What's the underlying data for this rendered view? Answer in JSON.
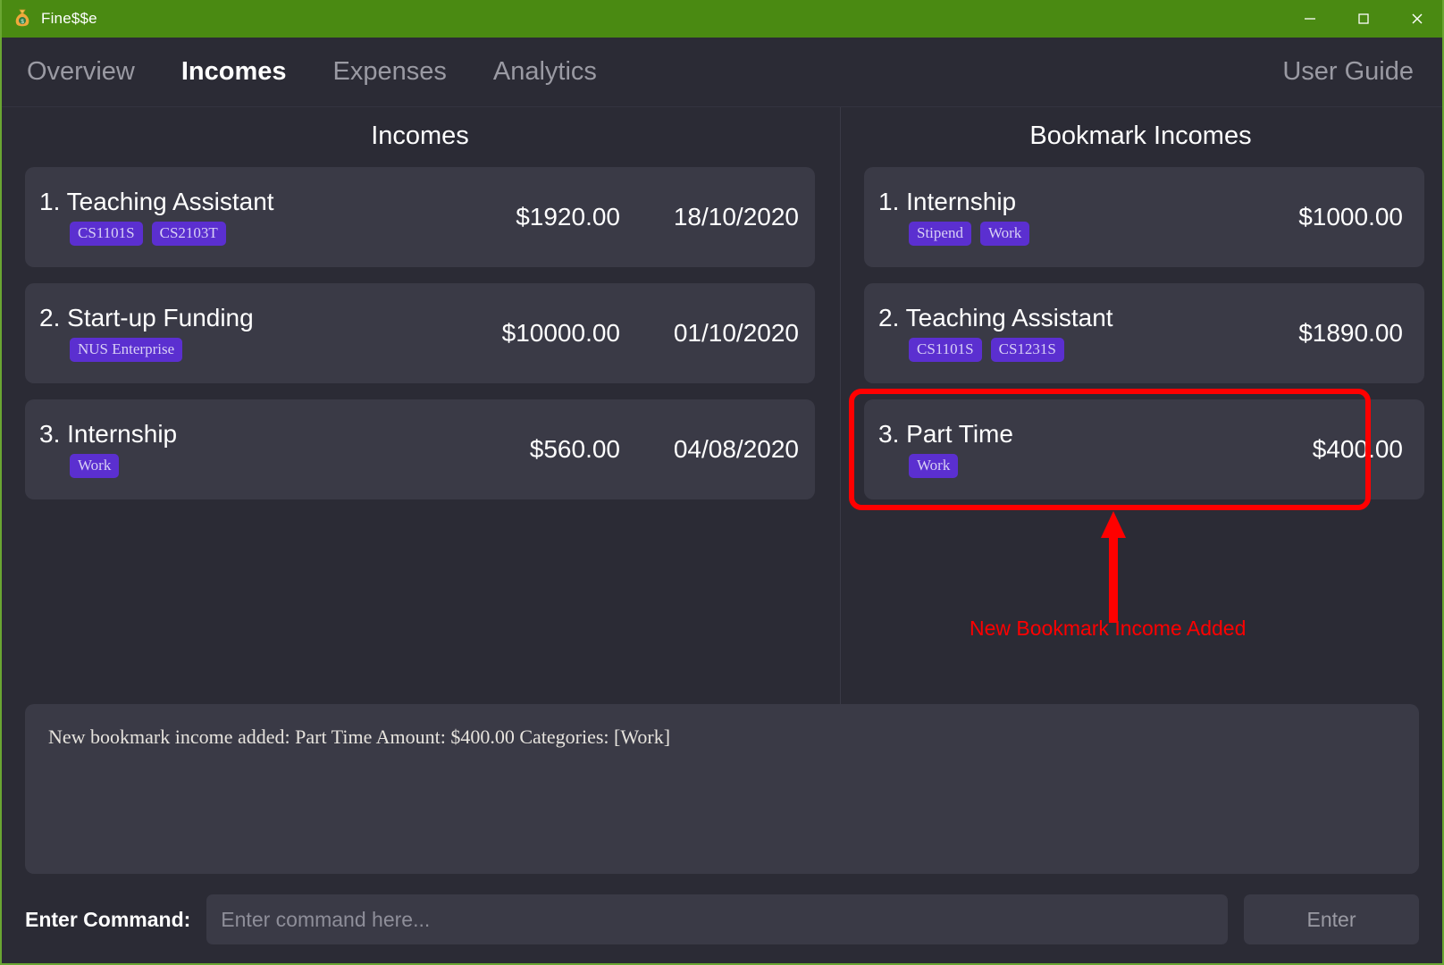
{
  "window": {
    "title": "Fine$$e",
    "icon": "money-bag-icon",
    "accent_color": "#4a8a12",
    "controls": {
      "minimize": "—",
      "maximize": "□",
      "close": "✕"
    }
  },
  "nav": {
    "items": [
      {
        "label": "Overview",
        "active": false
      },
      {
        "label": "Incomes",
        "active": true
      },
      {
        "label": "Expenses",
        "active": false
      },
      {
        "label": "Analytics",
        "active": false
      }
    ],
    "right_link": "User Guide"
  },
  "panels": {
    "left": {
      "title": "Incomes",
      "entries": [
        {
          "index": "1.",
          "name": "Teaching Assistant",
          "tags": [
            "CS1101S",
            "CS2103T"
          ],
          "amount": "$1920.00",
          "date": "18/10/2020"
        },
        {
          "index": "2.",
          "name": "Start-up Funding",
          "tags": [
            "NUS Enterprise"
          ],
          "amount": "$10000.00",
          "date": "01/10/2020"
        },
        {
          "index": "3.",
          "name": "Internship",
          "tags": [
            "Work"
          ],
          "amount": "$560.00",
          "date": "04/08/2020"
        }
      ]
    },
    "right": {
      "title": "Bookmark Incomes",
      "entries": [
        {
          "index": "1.",
          "name": "Internship",
          "tags": [
            "Stipend",
            "Work"
          ],
          "amount": "$1000.00",
          "date": ""
        },
        {
          "index": "2.",
          "name": "Teaching Assistant",
          "tags": [
            "CS1101S",
            "CS1231S"
          ],
          "amount": "$1890.00",
          "date": ""
        },
        {
          "index": "3.",
          "name": "Part Time",
          "tags": [
            "Work"
          ],
          "amount": "$400.00",
          "date": ""
        }
      ]
    }
  },
  "annotation": {
    "label": "New Bookmark Income Added",
    "color": "#ff0000",
    "highlight_target": "bookmark-entry-3-part-time"
  },
  "log": {
    "lines": [
      "New bookmark income added: Part Time Amount: $400.00 Categories: [Work]"
    ]
  },
  "command_bar": {
    "label": "Enter Command:",
    "placeholder": "Enter command here...",
    "value": "",
    "button_label": "Enter"
  },
  "colors": {
    "titlebar": "#4a8a12",
    "background": "#2b2b35",
    "card": "#3a3a46",
    "tag": "#5b2fd0",
    "tag_text": "#d8d0f5",
    "annotation": "#ff0000",
    "muted_text": "#9a9aa3"
  }
}
